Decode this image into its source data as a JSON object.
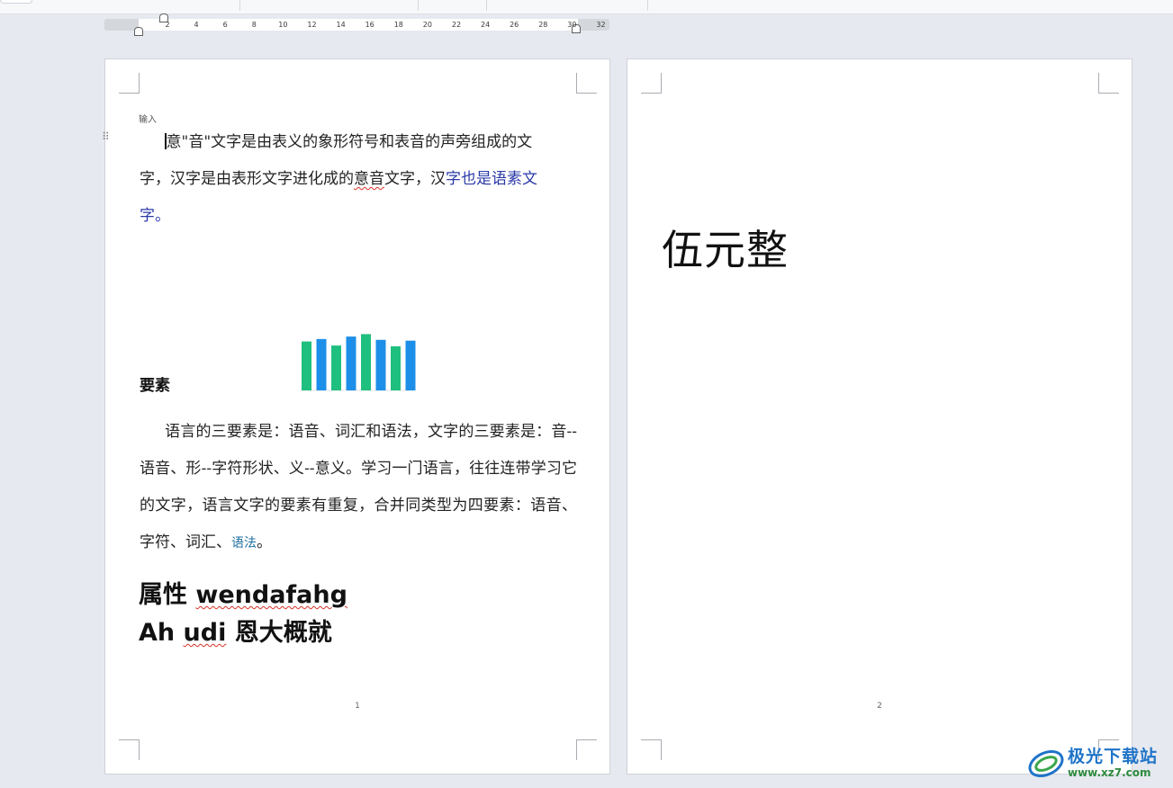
{
  "ruler": {
    "ticks": [
      "2",
      "4",
      "6",
      "8",
      "10",
      "12",
      "14",
      "16",
      "18",
      "20",
      "22",
      "24",
      "26",
      "28",
      "30",
      "32"
    ]
  },
  "page1": {
    "input_label": "输入",
    "para1": {
      "line1": "意\"音\"文字是由表义的象形符号和表音的声旁组成的文",
      "line2_pre": "字，汉字是由表形文字进化成的",
      "line2_err": "意音",
      "line2_mid": "文字，汉",
      "line2_blue": "字也是语素文",
      "line3_blue": "字。"
    },
    "heading": "要素",
    "para2": {
      "text": "语言的三要素是：语音、词汇和语法，文字的三要素是：音--语音、形--字符形状、义--意义。学习一门语言，往往连带学习它的文字，语言文字的要素有重复，合并同类型为四要素：语音、字符、词汇、",
      "teal": "语法",
      "end": "。"
    },
    "big_line1_cn": "属性 ",
    "big_line1_err": "wendafahg",
    "big_line2_pre": "Ah ",
    "big_line2_err": "udi",
    "big_line2_cn": " 恩大概就",
    "page_number": "1"
  },
  "page2": {
    "text": "伍元整",
    "page_number": "2"
  },
  "chart_data": {
    "type": "bar",
    "values": [
      60,
      63,
      55,
      66,
      69,
      62,
      54,
      61
    ],
    "colors": [
      "#1fbf7f",
      "#1e8fe8",
      "#1fbf7f",
      "#1e8fe8",
      "#1fbf7f",
      "#1e8fe8",
      "#1fbf7f",
      "#1e8fe8"
    ],
    "ylim": [
      0,
      75
    ],
    "grid": false
  },
  "watermark": {
    "title": "极光下载站",
    "url": "www.xz7.com"
  }
}
